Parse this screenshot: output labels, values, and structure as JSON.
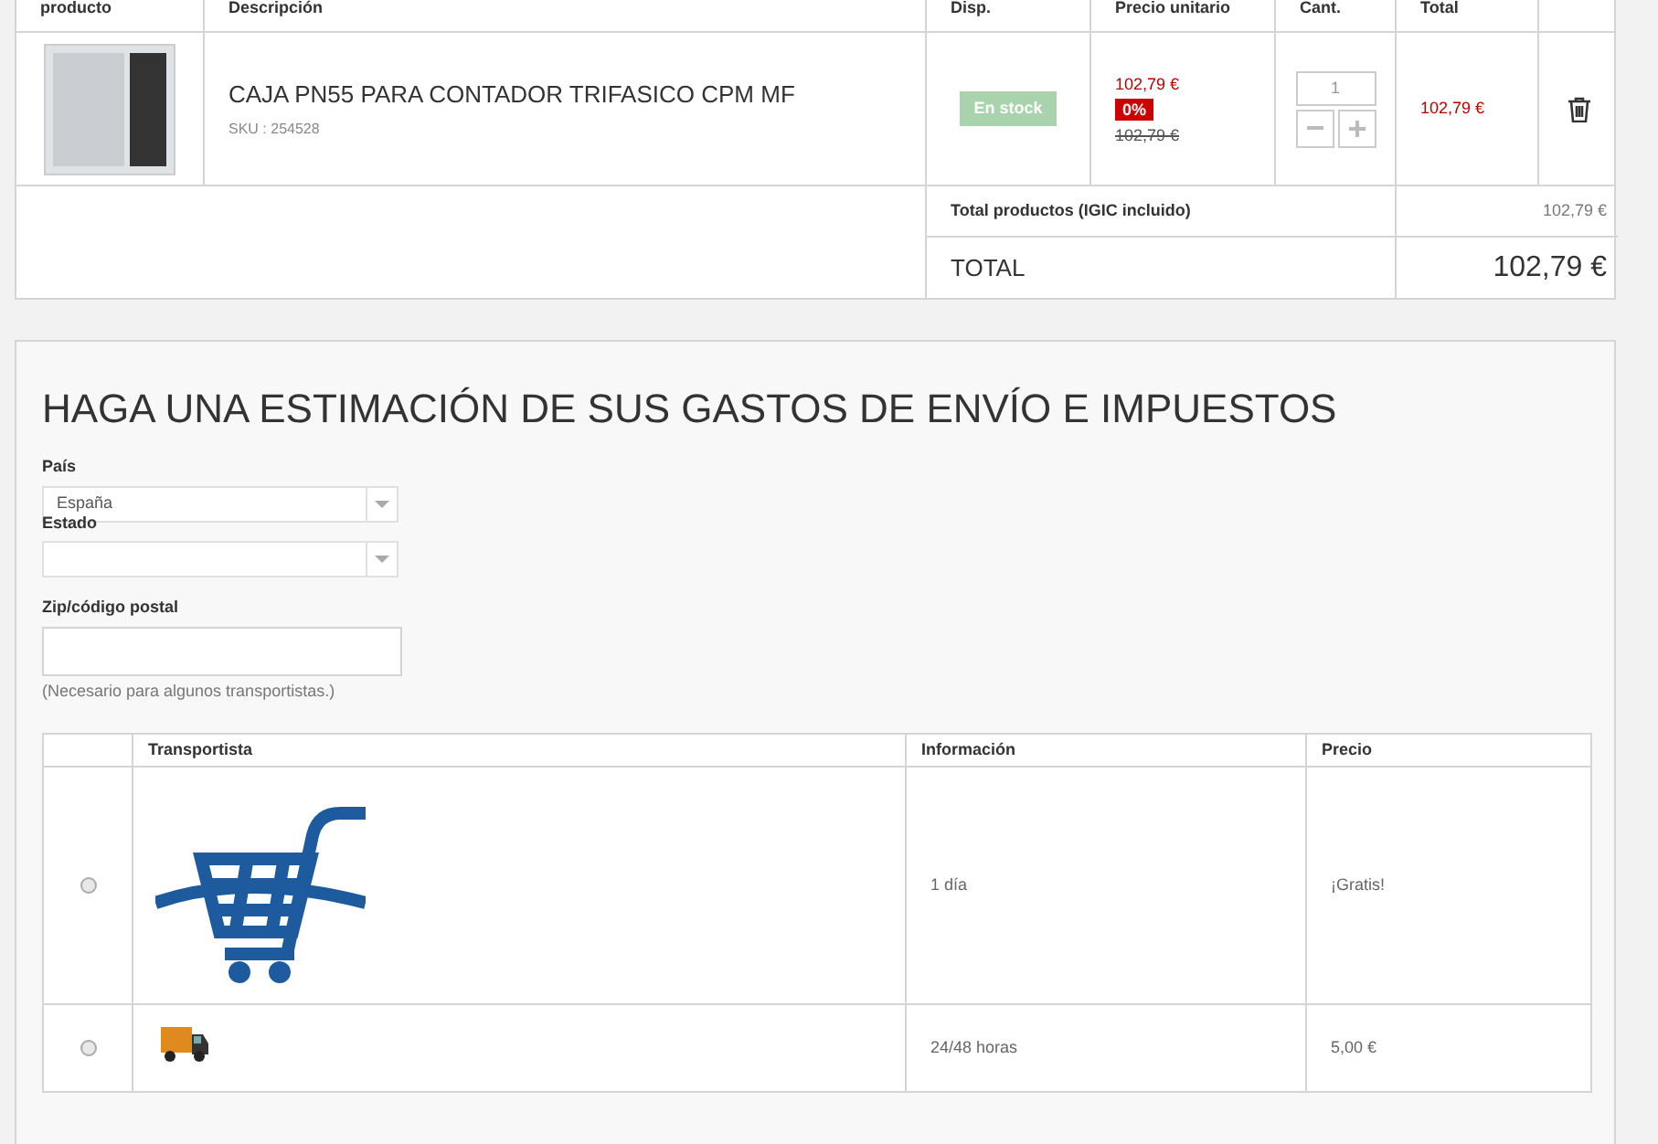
{
  "cart": {
    "columns": [
      "producto",
      "Descripción",
      "Disp.",
      "Precio unitario",
      "Cant.",
      "Total"
    ],
    "items": [
      {
        "name": "CAJA PN55 PARA CONTADOR TRIFASICO CPM MF",
        "sku": "SKU : 254528",
        "availability": "En stock",
        "price": "102,79 €",
        "discount": "0%",
        "old_price": "102,79 €",
        "quantity": "1",
        "total": "102,79 €"
      }
    ],
    "subtotal": {
      "label": "Total productos (IGIC incluido)",
      "value": "102,79 €"
    },
    "total": {
      "label": "TOTAL",
      "value": "102,79 €"
    }
  },
  "estimate": {
    "title": "HAGA UNA ESTIMACIÓN DE SUS GASTOS DE ENVÍO E IMPUESTOS",
    "country": {
      "label": "País",
      "value": "España"
    },
    "state": {
      "label": "Estado"
    },
    "zip": {
      "label": "Zip/código postal",
      "note": "(Necesario para algunos transportistas.)"
    },
    "carriers": {
      "columns": [
        "Transportista",
        "Información",
        "Precio"
      ],
      "rows": [
        {
          "kind": "cart",
          "selected": false,
          "info": "1 día",
          "price": "¡Gratis!"
        },
        {
          "kind": "truck",
          "selected": false,
          "info": "24/48 horas",
          "price": "5,00 €"
        }
      ]
    }
  }
}
